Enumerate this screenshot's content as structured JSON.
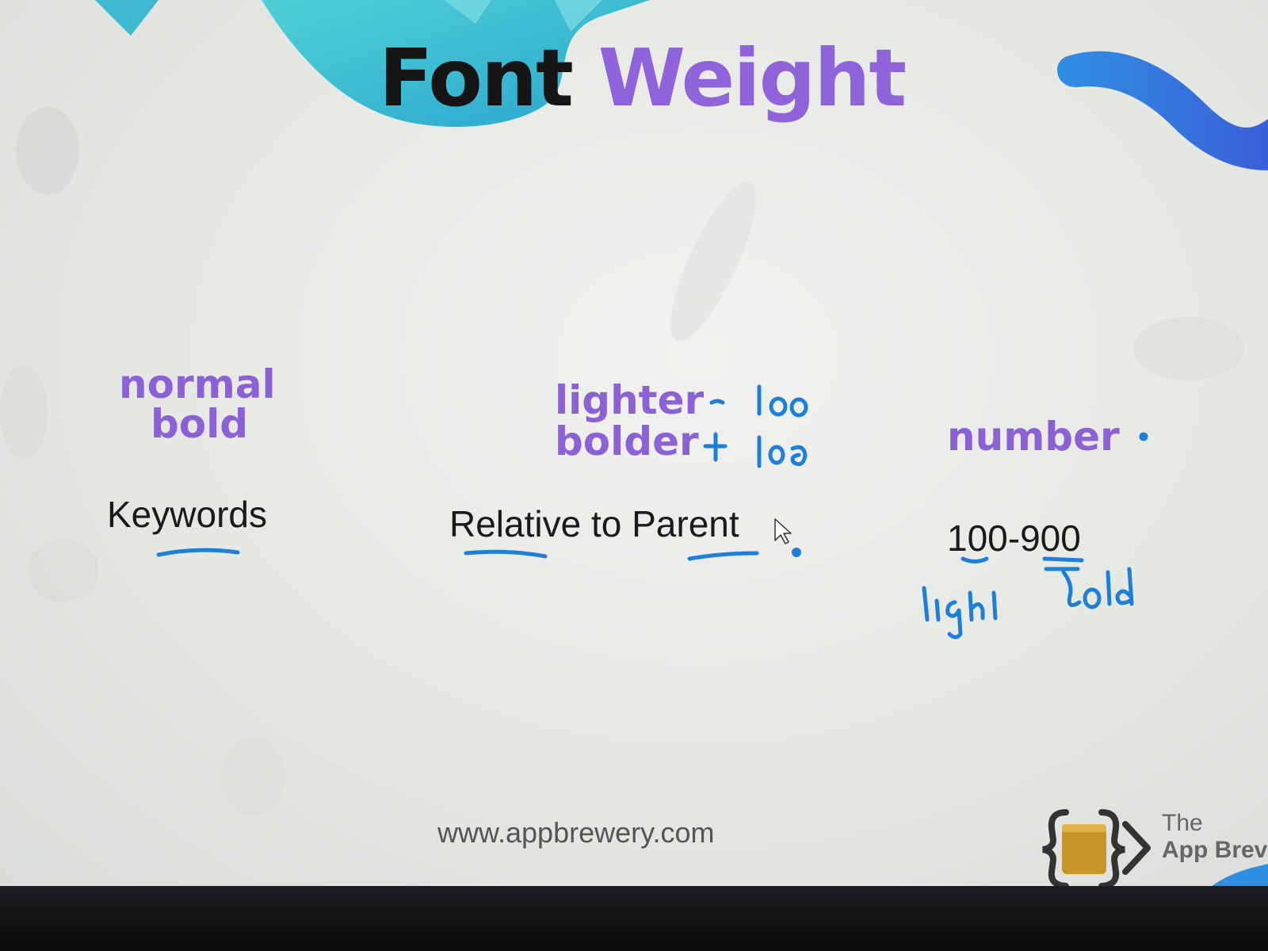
{
  "slide": {
    "title_part1": "Font",
    "title_part2": "Weight",
    "columns": [
      {
        "keywords": [
          "normal",
          "bold"
        ],
        "category": "Keywords"
      },
      {
        "keywords": [
          "lighter",
          "bolder"
        ],
        "category": "Relative to Parent"
      },
      {
        "keywords": [
          "number"
        ],
        "category": "100-900"
      }
    ],
    "footer_url": "www.appbrewery.com",
    "logo_line1": "The",
    "logo_line2": "App Brev"
  },
  "annotations": {
    "lighter_note": "- 100",
    "bolder_note": "+ 100",
    "light_label": "light",
    "bold_label": "bold"
  },
  "colors": {
    "title_black": "#151515",
    "accent_purple": "#8f63d9",
    "pen_blue": "#1f7fd6",
    "blob_teal": "#35b6d0",
    "blob_blue": "#2f6fdc"
  }
}
